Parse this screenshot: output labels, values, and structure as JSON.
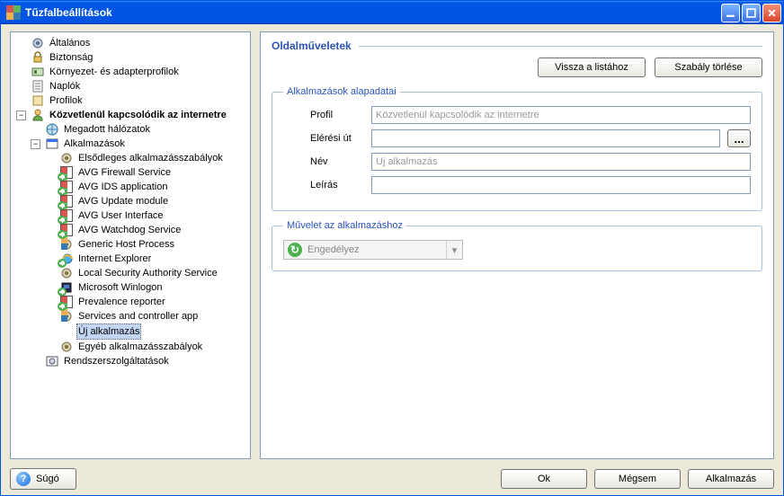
{
  "window": {
    "title": "Tűzfalbeállítások"
  },
  "winButtons": {
    "min": "Minimize",
    "max": "Maximize",
    "close": "Close"
  },
  "tree": {
    "altalanos": "Általános",
    "biztonsag": "Biztonság",
    "kornyezet": "Környezet- és adapterprofilok",
    "naplok": "Naplók",
    "profilok": "Profilok",
    "kozvetlenul": "Közvetlenül kapcsolódik az internetre",
    "megadott": "Megadott hálózatok",
    "alkalmazasok": "Alkalmazások",
    "elsodleges": "Elsődleges alkalmazásszabályok",
    "avg_firewall": "AVG Firewall Service",
    "avg_ids": "AVG IDS application",
    "avg_update": "AVG Update module",
    "avg_ui": "AVG User Interface",
    "avg_watchdog": "AVG Watchdog Service",
    "generic_host": "Generic Host Process",
    "ie": "Internet Explorer",
    "lsas": "Local Security Authority Service",
    "winlogon": "Microsoft Winlogon",
    "prevalence": "Prevalence reporter",
    "services_ctrl": "Services and controller app",
    "uj_alkalmazas": "Új alkalmazás",
    "egyeb": "Egyéb alkalmazásszabályok",
    "rendszer": "Rendszerszolgáltatások"
  },
  "page": {
    "header": "Oldalműveletek",
    "back_to_list": "Vissza a listához",
    "delete_rule": "Szabály törlése"
  },
  "appdata": {
    "legend": "Alkalmazások alapadatai",
    "profile_label": "Profil",
    "profile_value": "Közvetlenül kapcsolódik az internetre",
    "path_label": "Elérési út",
    "path_value": "",
    "browse": "...",
    "name_label": "Név",
    "name_value": "Új alkalmazás",
    "desc_label": "Leírás",
    "desc_value": ""
  },
  "action": {
    "legend": "Művelet az alkalmazáshoz",
    "selected": "Engedélyez"
  },
  "buttons": {
    "help": "Súgó",
    "ok": "Ok",
    "cancel": "Mégsem",
    "apply": "Alkalmazás"
  }
}
